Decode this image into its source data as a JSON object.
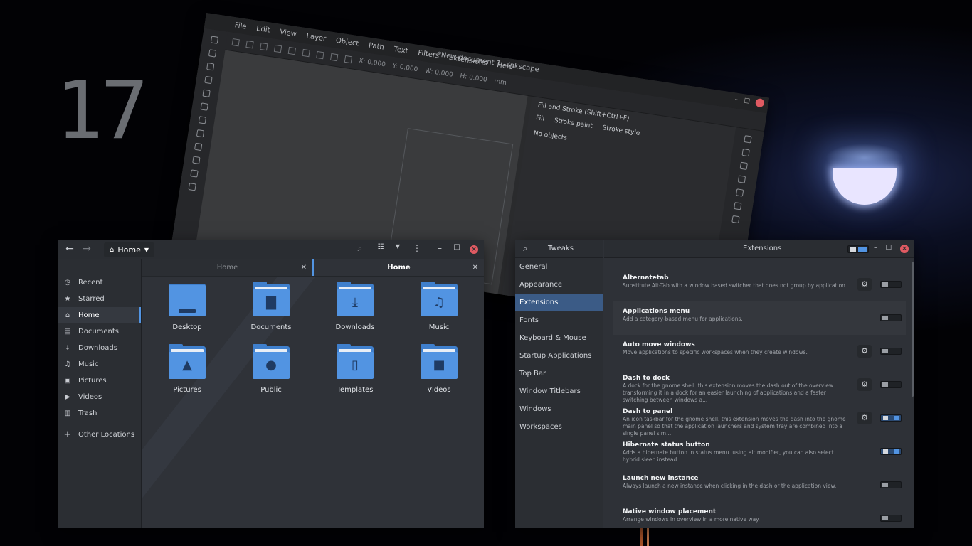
{
  "desktop": {
    "clock_digits": "17"
  },
  "inkscape": {
    "title": "*New document 1 - Inkscape",
    "menu": [
      "File",
      "Edit",
      "View",
      "Layer",
      "Object",
      "Path",
      "Text",
      "Filters",
      "Extensions",
      "Help"
    ],
    "toolbar_fields": [
      "X: 0.000",
      "Y: 0.000",
      "W: 0.000",
      "H: 0.000",
      "mm"
    ],
    "panel": {
      "title": "Fill and Stroke (Shift+Ctrl+F)",
      "tabs": [
        "Fill",
        "Stroke paint",
        "Stroke style"
      ],
      "status": "No objects"
    }
  },
  "files": {
    "location": "Home",
    "tabs": [
      {
        "label": "Home",
        "active": false
      },
      {
        "label": "Home",
        "active": true
      }
    ],
    "sidebar": [
      {
        "label": "Recent",
        "icon": "clock-icon"
      },
      {
        "label": "Starred",
        "icon": "star-icon"
      },
      {
        "label": "Home",
        "icon": "home-icon",
        "active": true
      },
      {
        "label": "Documents",
        "icon": "document-icon"
      },
      {
        "label": "Downloads",
        "icon": "download-icon"
      },
      {
        "label": "Music",
        "icon": "music-icon"
      },
      {
        "label": "Pictures",
        "icon": "picture-icon"
      },
      {
        "label": "Videos",
        "icon": "video-icon"
      },
      {
        "label": "Trash",
        "icon": "trash-icon"
      },
      {
        "label": "Other Locations",
        "icon": "plus-icon"
      }
    ],
    "folders": [
      {
        "label": "Desktop",
        "icon": "desktop-folder-icon"
      },
      {
        "label": "Documents",
        "icon": "documents-folder-icon"
      },
      {
        "label": "Downloads",
        "icon": "downloads-folder-icon"
      },
      {
        "label": "Music",
        "icon": "music-folder-icon"
      },
      {
        "label": "Pictures",
        "icon": "pictures-folder-icon"
      },
      {
        "label": "Public",
        "icon": "public-folder-icon"
      },
      {
        "label": "Templates",
        "icon": "templates-folder-icon"
      },
      {
        "label": "Videos",
        "icon": "videos-folder-icon"
      }
    ],
    "accent": "#5294e2"
  },
  "tweaks": {
    "app_title": "Tweaks",
    "page_title": "Extensions",
    "sidebar": [
      {
        "label": "General"
      },
      {
        "label": "Appearance"
      },
      {
        "label": "Extensions",
        "active": true
      },
      {
        "label": "Fonts"
      },
      {
        "label": "Keyboard & Mouse"
      },
      {
        "label": "Startup Applications"
      },
      {
        "label": "Top Bar"
      },
      {
        "label": "Window Titlebars"
      },
      {
        "label": "Windows"
      },
      {
        "label": "Workspaces"
      }
    ],
    "extensions": [
      {
        "name": "Alternatetab",
        "desc": "Substitute Alt-Tab with a window based switcher that does not group by application.",
        "settings": true,
        "enabled": false
      },
      {
        "name": "Applications menu",
        "desc": "Add a category-based menu for applications.",
        "settings": false,
        "enabled": false
      },
      {
        "name": "Auto move windows",
        "desc": "Move applications to specific workspaces when they create windows.",
        "settings": true,
        "enabled": false
      },
      {
        "name": "Dash to dock",
        "desc": "A dock for the gnome shell. this extension moves the dash out of the overview transforming it in a dock for an easier launching of applications and a faster switching between windows a...",
        "settings": true,
        "enabled": false
      },
      {
        "name": "Dash to panel",
        "desc": "An icon taskbar for the gnome shell. this extension moves the dash into the gnome main panel so that the application launchers and system tray are combined into a single panel sim...",
        "settings": true,
        "enabled": true
      },
      {
        "name": "Hibernate status button",
        "desc": "Adds a hibernate button in status menu. using alt modifier, you can also select hybrid sleep instead.",
        "settings": false,
        "enabled": true
      },
      {
        "name": "Launch new instance",
        "desc": "Always launch a new instance when clicking in the dash or the application view.",
        "settings": false,
        "enabled": false
      },
      {
        "name": "Native window placement",
        "desc": "Arrange windows in overview in a more native way.",
        "settings": false,
        "enabled": false
      }
    ]
  }
}
